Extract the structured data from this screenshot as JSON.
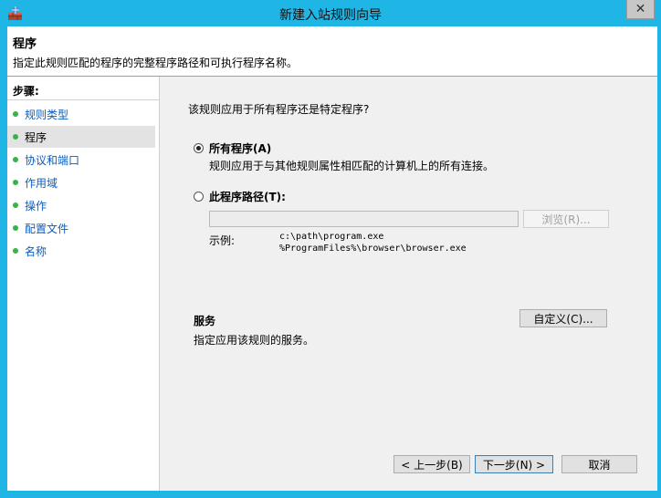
{
  "window": {
    "title": "新建入站规则向导",
    "close_glyph": "✕"
  },
  "header": {
    "title": "程序",
    "subtitle": "指定此规则匹配的程序的完整程序路径和可执行程序名称。"
  },
  "steps": {
    "title": "步骤:",
    "items": [
      {
        "label": "规则类型"
      },
      {
        "label": "程序"
      },
      {
        "label": "协议和端口"
      },
      {
        "label": "作用域"
      },
      {
        "label": "操作"
      },
      {
        "label": "配置文件"
      },
      {
        "label": "名称"
      }
    ],
    "active_index": 1,
    "dot_color": "#38b24a"
  },
  "main": {
    "question": "该规则应用于所有程序还是特定程序?",
    "all_programs": {
      "label": "所有程序(A)",
      "description": "规则应用于与其他规则属性相匹配的计算机上的所有连接。",
      "selected": true
    },
    "program_path": {
      "label": "此程序路径(T):",
      "value": "",
      "selected": false
    },
    "browse_button": "浏览(R)...",
    "example_label": "示例:",
    "example_lines": [
      "c:\\path\\program.exe",
      "%ProgramFiles%\\browser\\browser.exe"
    ],
    "services": {
      "title": "服务",
      "description": "指定应用该规则的服务。",
      "button": "自定义(C)..."
    }
  },
  "footer": {
    "back": "< 上一步(B)",
    "next": "下一步(N) >",
    "cancel": "取消"
  },
  "colors": {
    "title_bar": "#1fb6e6",
    "link": "#0b5dbf"
  }
}
